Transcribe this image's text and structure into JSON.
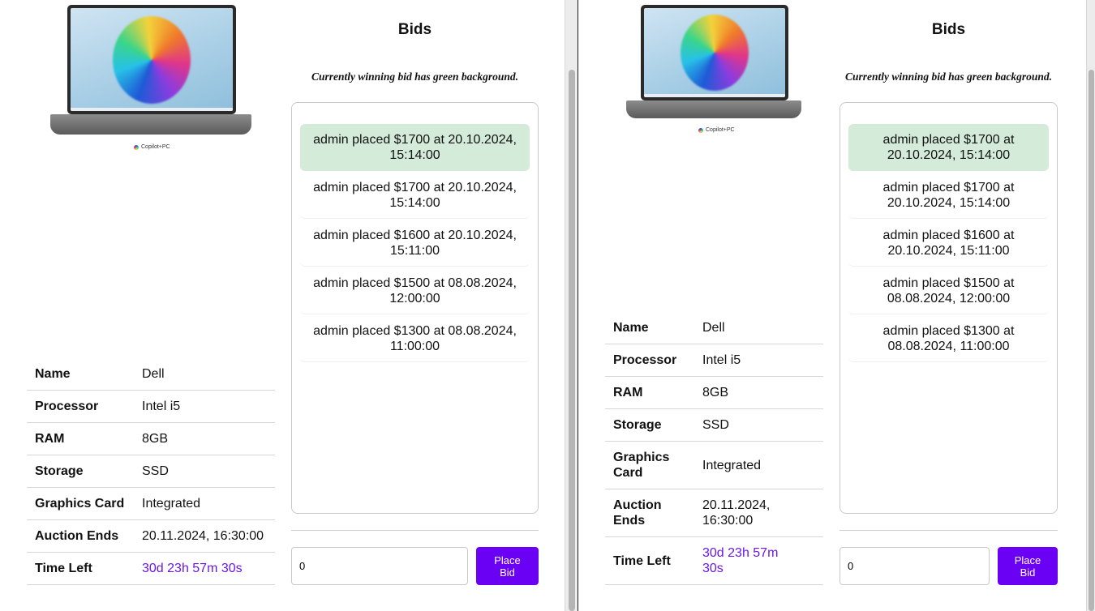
{
  "bids_section": {
    "title": "Bids",
    "note": "Currently winning bid has green background."
  },
  "product_image": {
    "badge": "Copilot+PC",
    "icon": "laptop-image"
  },
  "specs": [
    {
      "label": "Name",
      "value": "Dell"
    },
    {
      "label": "Processor",
      "value": "Intel i5"
    },
    {
      "label": "RAM",
      "value": "8GB"
    },
    {
      "label": "Storage",
      "value": "SSD"
    },
    {
      "label": "Graphics Card",
      "value": "Integrated"
    },
    {
      "label": "Auction Ends",
      "value": "20.11.2024, 16:30:00"
    },
    {
      "label": "Time Left",
      "value": "30d 23h 57m 30s"
    }
  ],
  "bids": [
    {
      "text": "admin placed $1700 at 20.10.2024, 15:14:00",
      "winning": true
    },
    {
      "text": "admin placed $1700 at 20.10.2024, 15:14:00",
      "winning": false
    },
    {
      "text": "admin placed $1600 at 20.10.2024, 15:11:00",
      "winning": false
    },
    {
      "text": "admin placed $1500 at 08.08.2024, 12:00:00",
      "winning": false
    },
    {
      "text": "admin placed $1300 at 08.08.2024, 11:00:00",
      "winning": false
    }
  ],
  "bid_form": {
    "amount_value": "0",
    "place_bid_label": "Place Bid"
  },
  "colors": {
    "winning_bid_bg": "#d4ebd9",
    "accent": "#6a00f4",
    "countdown": "#6b17e6"
  }
}
